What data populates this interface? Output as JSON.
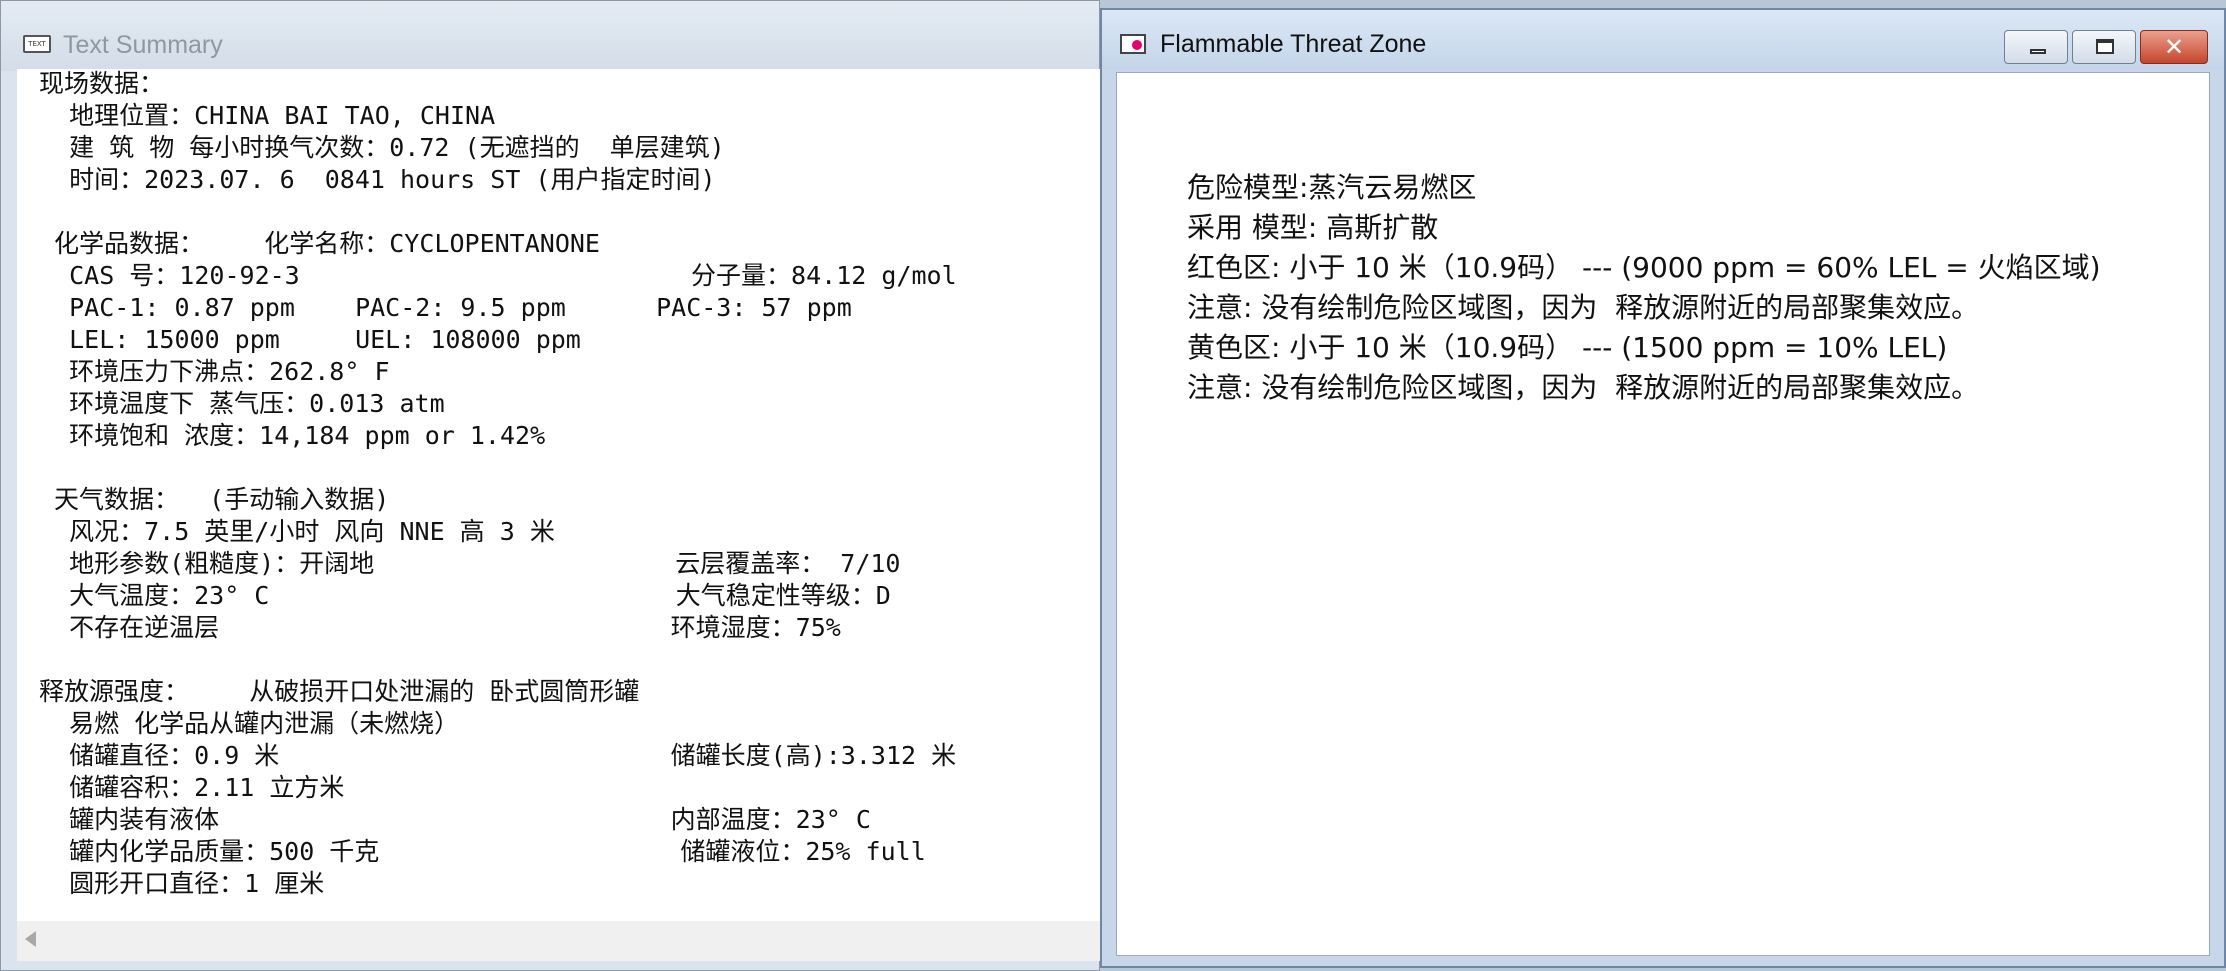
{
  "left_window": {
    "title": "Text Summary",
    "icon": "text-document-icon",
    "icon_caption": "TEXT",
    "lines": [
      "现场数据：",
      "  地理位置：CHINA BAI TAO, CHINA",
      "  建 筑 物 每小时换气次数：0.72 (无遮挡的  单层建筑)",
      "  时间：2023.07. 6  0841 hours ST (用户指定时间)",
      "",
      " 化学品数据：    化学名称：CYCLOPENTANONE",
      "  CAS 号：120-92-3                          分子量：84.12 g/mol",
      "  PAC-1: 0.87 ppm    PAC-2: 9.5 ppm      PAC-3: 57 ppm",
      "  LEL: 15000 ppm     UEL: 108000 ppm",
      "  环境压力下沸点：262.8° F",
      "  环境温度下 蒸气压：0.013 atm",
      "  环境饱和 浓度：14,184 ppm or 1.42%",
      "",
      " 天气数据：  (手动输入数据)",
      "  风况：7.5 英里/小时 风向 NNE 高 3 米",
      "  地形参数(粗糙度)：开阔地                    云层覆盖率： 7/10",
      "  大气温度：23° C                           大气稳定性等级：D",
      "  不存在逆温层                              环境湿度：75%",
      "",
      "释放源强度：    从破损开口处泄漏的 卧式圆筒形罐",
      "  易燃 化学品从罐内泄漏（未燃烧）",
      "  储罐直径：0.9 米                          储罐长度(高):3.312 米",
      "  储罐容积：2.11 立方米",
      "  罐内装有液体                              内部温度：23° C",
      "  罐内化学品质量：500 千克                    储罐液位：25% full",
      "  圆形开口直径：1 厘米"
    ]
  },
  "right_window": {
    "title": "Flammable Threat Zone",
    "icon": "threat-zone-icon",
    "icon_color": "#e2006d",
    "controls": {
      "minimize": "minimize-icon",
      "maximize": "maximize-icon",
      "close": "close-icon",
      "close_glyph": "✕"
    },
    "lines": [
      "危险模型:蒸汽云易燃区",
      "采用 模型: 高斯扩散",
      "红色区: 小于 10 米（10.9码） --- (9000 ppm = 60% LEL = 火焰区域)",
      "注意: 没有绘制危险区域图，因为  释放源附近的局部聚集效应。",
      "黄色区: 小于 10 米（10.9码） --- (1500 ppm = 10% LEL)",
      "注意: 没有绘制危险区域图，因为  释放源附近的局部聚集效应。"
    ]
  }
}
